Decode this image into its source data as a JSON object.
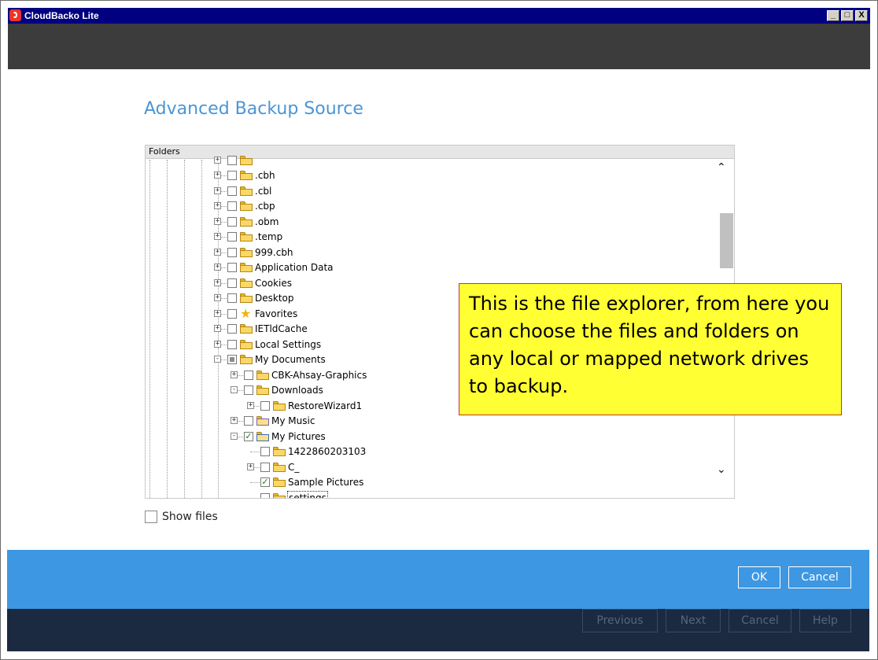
{
  "window": {
    "title": "CloudBacko Lite",
    "controls": {
      "minimize": "_",
      "restore": "□",
      "close": "X"
    }
  },
  "page": {
    "title": "Advanced Backup Source"
  },
  "tree": {
    "header": "Folders",
    "items": [
      {
        "label": ".cbh",
        "state": "unchecked",
        "icon": "folder-icon"
      },
      {
        "label": ".cbl",
        "state": "unchecked",
        "icon": "folder-icon"
      },
      {
        "label": ".cbp",
        "state": "unchecked",
        "icon": "folder-icon"
      },
      {
        "label": ".obm",
        "state": "unchecked",
        "icon": "folder-icon"
      },
      {
        "label": ".temp",
        "state": "unchecked",
        "icon": "folder-icon"
      },
      {
        "label": "999.cbh",
        "state": "unchecked",
        "icon": "folder-icon"
      },
      {
        "label": "Application Data",
        "state": "unchecked",
        "icon": "folder-icon"
      },
      {
        "label": "Cookies",
        "state": "unchecked",
        "icon": "folder-icon"
      },
      {
        "label": "Desktop",
        "state": "unchecked",
        "icon": "folder-icon"
      },
      {
        "label": "Favorites",
        "state": "unchecked",
        "icon": "star-icon"
      },
      {
        "label": "IETldCache",
        "state": "unchecked",
        "icon": "folder-icon"
      },
      {
        "label": "Local Settings",
        "state": "unchecked",
        "icon": "folder-icon"
      },
      {
        "label": "My Documents",
        "state": "partial",
        "icon": "folder-icon"
      },
      {
        "label": "CBK-Ahsay-Graphics",
        "state": "unchecked",
        "icon": "folder-icon"
      },
      {
        "label": "Downloads",
        "state": "unchecked",
        "icon": "folder-icon"
      },
      {
        "label": "RestoreWizard1",
        "state": "unchecked",
        "icon": "folder-icon"
      },
      {
        "label": "My Music",
        "state": "unchecked",
        "icon": "music-folder-icon"
      },
      {
        "label": "My Pictures",
        "state": "checked",
        "icon": "pictures-folder-icon"
      },
      {
        "label": "1422860203103",
        "state": "unchecked",
        "icon": "folder-icon"
      },
      {
        "label": "C_",
        "state": "unchecked",
        "icon": "folder-icon"
      },
      {
        "label": "Sample Pictures",
        "state": "checked",
        "icon": "shortcut-folder-icon"
      },
      {
        "label": "settings",
        "state": "unchecked",
        "icon": "folder-icon"
      }
    ]
  },
  "callout": {
    "text": "This is the file explorer, from here you can choose the files and folders on any local or mapped network drives to backup."
  },
  "show_files": {
    "label": "Show files",
    "checked": false
  },
  "dialog_buttons": {
    "ok": "OK",
    "cancel": "Cancel"
  },
  "wizard_buttons": {
    "previous": "Previous",
    "next": "Next",
    "cancel": "Cancel",
    "help": "Help"
  },
  "colors": {
    "title_blue": "#4a95d6",
    "action_band": "#3d97e3",
    "footer_navy": "#1b2a41",
    "callout_yellow": "#ffff33",
    "header_dark": "#3c3c3c"
  }
}
